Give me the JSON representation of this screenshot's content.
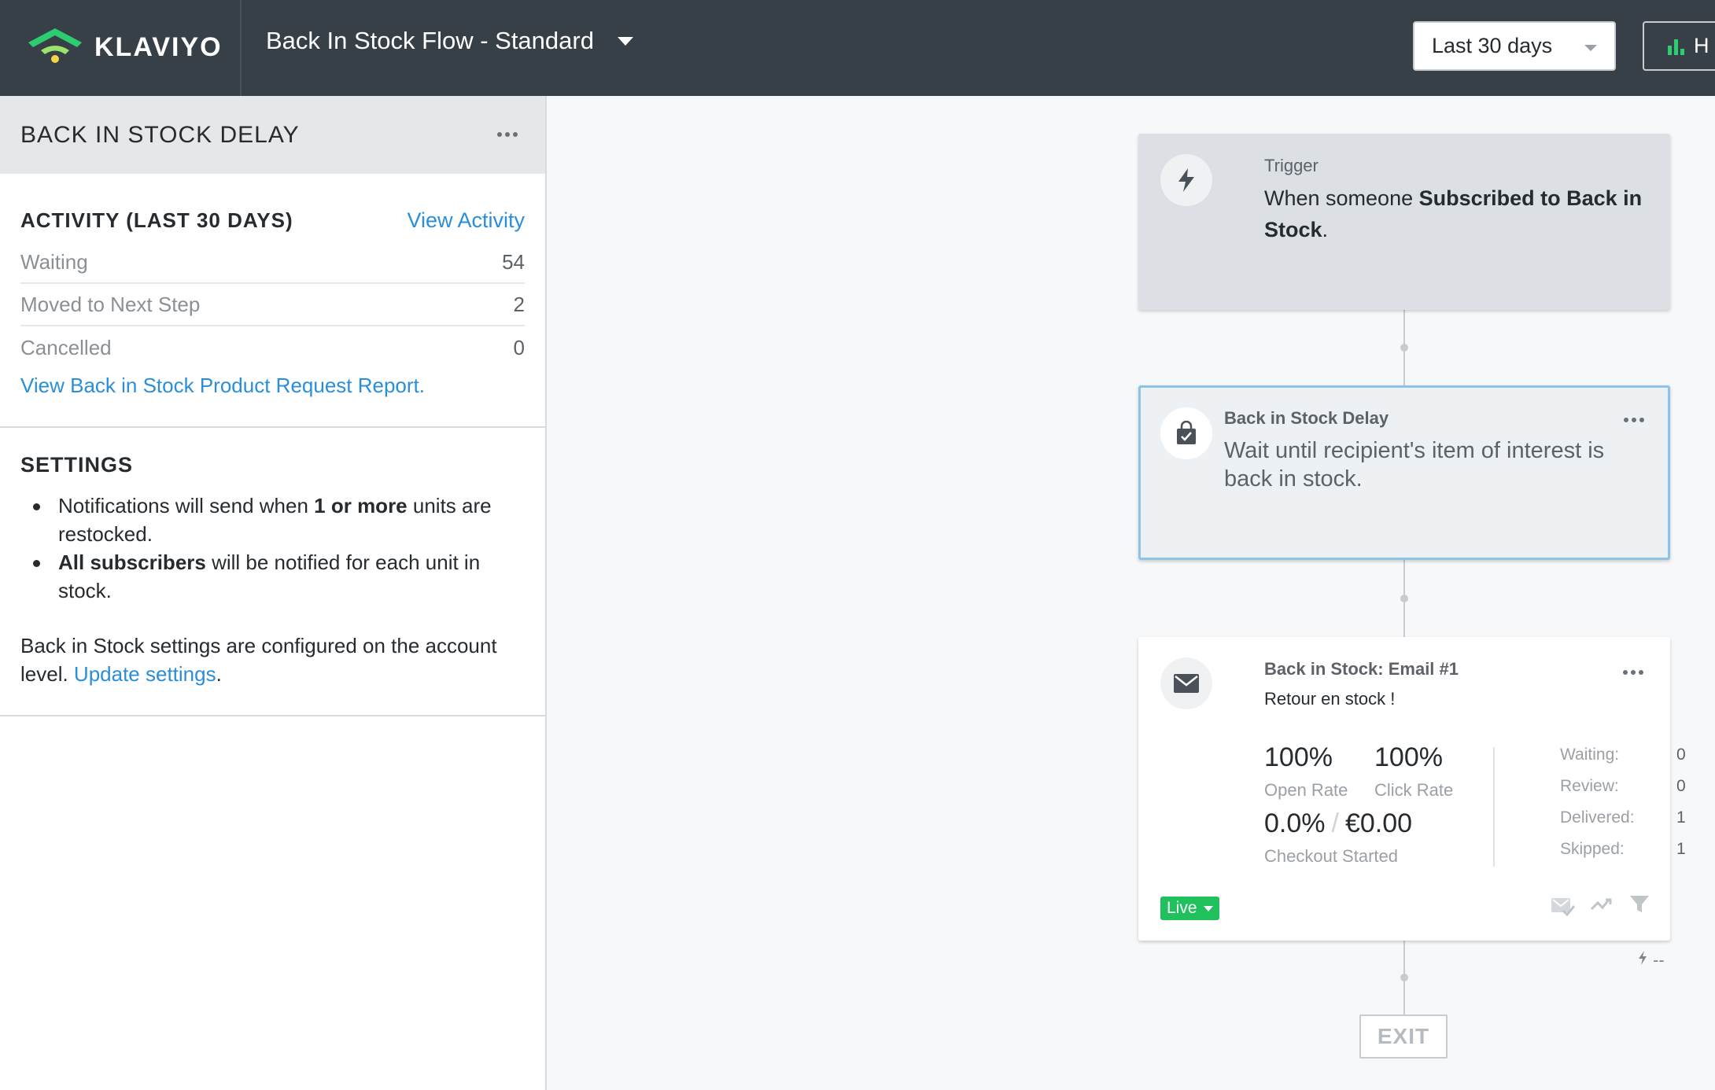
{
  "header": {
    "brand": "KLAVIYO",
    "flow_title": "Back In Stock Flow - Standard",
    "date_range": "Last 30 days",
    "right_button_label": "H"
  },
  "left_panel": {
    "title": "BACK IN STOCK DELAY",
    "activity": {
      "heading": "ACTIVITY (LAST 30 DAYS)",
      "view_link": "View Activity",
      "rows": [
        {
          "label": "Waiting",
          "value": "54"
        },
        {
          "label": "Moved to Next Step",
          "value": "2"
        },
        {
          "label": "Cancelled",
          "value": "0"
        }
      ],
      "report_link": "View Back in Stock Product Request Report."
    },
    "settings": {
      "heading": "SETTINGS",
      "bullet1": {
        "pre": "Notifications will send when ",
        "bold": "1 or more",
        "post": " units are restocked."
      },
      "bullet2": {
        "bold": "All subscribers",
        "post": " will be notified for each unit in stock."
      },
      "note": "Back in Stock settings are configured on the account level. ",
      "note_link": "Update settings",
      "note_end": "."
    }
  },
  "flow": {
    "trigger": {
      "kicker": "Trigger",
      "pre": "When someone ",
      "bold": "Subscribed to Back in Stock",
      "post": "."
    },
    "delay": {
      "kicker": "Back in Stock Delay",
      "body": "Wait until recipient's item of interest is back in stock."
    },
    "email": {
      "kicker": "Back in Stock: Email #1",
      "subject": "Retour en stock !",
      "open_rate": "100%",
      "open_rate_label": "Open Rate",
      "click_rate": "100%",
      "click_rate_label": "Click Rate",
      "checkout_pct": "0.0%",
      "checkout_sep": "/",
      "checkout_value": "€0.00",
      "checkout_label": "Checkout Started",
      "counts": [
        {
          "label": "Waiting:",
          "value": "0"
        },
        {
          "label": "Review:",
          "value": "0"
        },
        {
          "label": "Delivered:",
          "value": "1"
        },
        {
          "label": "Skipped:",
          "value": "1"
        }
      ],
      "status": "Live",
      "trigger_note": "--"
    },
    "exit_label": "EXIT"
  },
  "colors": {
    "topbar": "#373f47",
    "accent_link": "#2a8ed9",
    "live_badge": "#20c05c",
    "selected_border": "#8ec3e8",
    "brand_green": "#2ecc71"
  },
  "icons": [
    "klaviyo-logo-icon",
    "chevron-down-icon",
    "bar-chart-icon",
    "more-dots-icon",
    "lightning-icon",
    "shopping-bag-icon",
    "envelope-icon",
    "mail-check-icon",
    "trend-icon",
    "filter-icon"
  ]
}
